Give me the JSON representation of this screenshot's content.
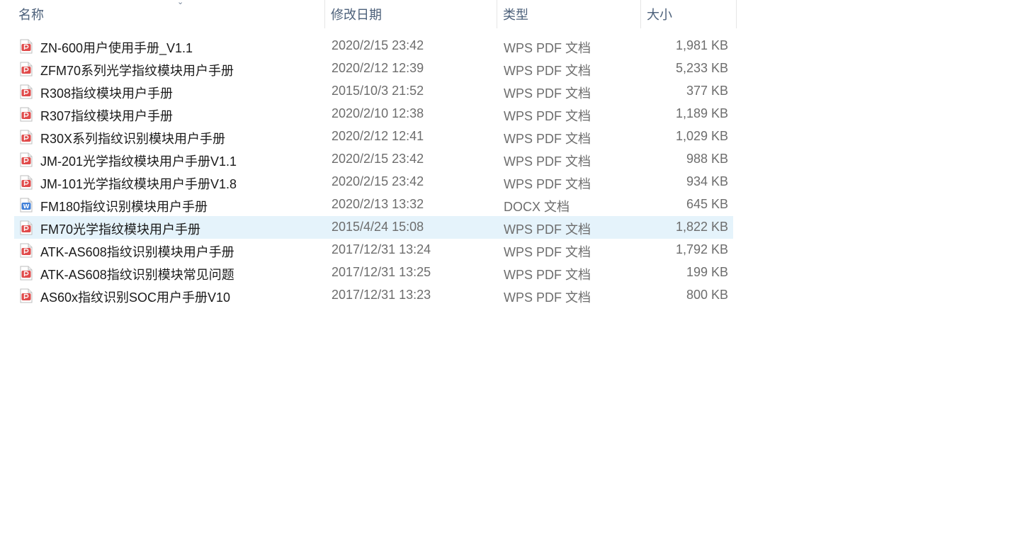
{
  "columns": {
    "name": "名称",
    "date": "修改日期",
    "type": "类型",
    "size": "大小"
  },
  "sort_indicator": "chevron-down-icon",
  "colors": {
    "pdf_icon": "#e04a4a",
    "docx_icon": "#3f7fd8",
    "selected_row": "#e5f3fb",
    "header_text": "#4c607a",
    "meta_text": "#6d6d6d"
  },
  "files": [
    {
      "name": "ZN-600用户使用手册_V1.1",
      "date": "2020/2/15 23:42",
      "type": "WPS PDF 文档",
      "size": "1,981 KB",
      "icon": "pdf-file-icon",
      "selected": false
    },
    {
      "name": "ZFM70系列光学指纹模块用户手册",
      "date": "2020/2/12 12:39",
      "type": "WPS PDF 文档",
      "size": "5,233 KB",
      "icon": "pdf-file-icon",
      "selected": false
    },
    {
      "name": "R308指纹模块用户手册",
      "date": "2015/10/3 21:52",
      "type": "WPS PDF 文档",
      "size": "377 KB",
      "icon": "pdf-file-icon",
      "selected": false
    },
    {
      "name": "R307指纹模块用户手册",
      "date": "2020/2/10 12:38",
      "type": "WPS PDF 文档",
      "size": "1,189 KB",
      "icon": "pdf-file-icon",
      "selected": false
    },
    {
      "name": "R30X系列指纹识别模块用户手册",
      "date": "2020/2/12 12:41",
      "type": "WPS PDF 文档",
      "size": "1,029 KB",
      "icon": "pdf-file-icon",
      "selected": false
    },
    {
      "name": "JM-201光学指纹模块用户手册V1.1",
      "date": "2020/2/15 23:42",
      "type": "WPS PDF 文档",
      "size": "988 KB",
      "icon": "pdf-file-icon",
      "selected": false
    },
    {
      "name": "JM-101光学指纹模块用户手册V1.8",
      "date": "2020/2/15 23:42",
      "type": "WPS PDF 文档",
      "size": "934 KB",
      "icon": "pdf-file-icon",
      "selected": false
    },
    {
      "name": "FM180指纹识别模块用户手册",
      "date": "2020/2/13 13:32",
      "type": "DOCX 文档",
      "size": "645 KB",
      "icon": "docx-file-icon",
      "selected": false
    },
    {
      "name": "FM70光学指纹模块用户手册",
      "date": "2015/4/24 15:08",
      "type": "WPS PDF 文档",
      "size": "1,822 KB",
      "icon": "pdf-file-icon",
      "selected": true
    },
    {
      "name": "ATK-AS608指纹识别模块用户手册",
      "date": "2017/12/31 13:24",
      "type": "WPS PDF 文档",
      "size": "1,792 KB",
      "icon": "pdf-file-icon",
      "selected": false
    },
    {
      "name": "ATK-AS608指纹识别模块常见问题",
      "date": "2017/12/31 13:25",
      "type": "WPS PDF 文档",
      "size": "199 KB",
      "icon": "pdf-file-icon",
      "selected": false
    },
    {
      "name": "AS60x指纹识别SOC用户手册V10",
      "date": "2017/12/31 13:23",
      "type": "WPS PDF 文档",
      "size": "800 KB",
      "icon": "pdf-file-icon",
      "selected": false
    }
  ]
}
